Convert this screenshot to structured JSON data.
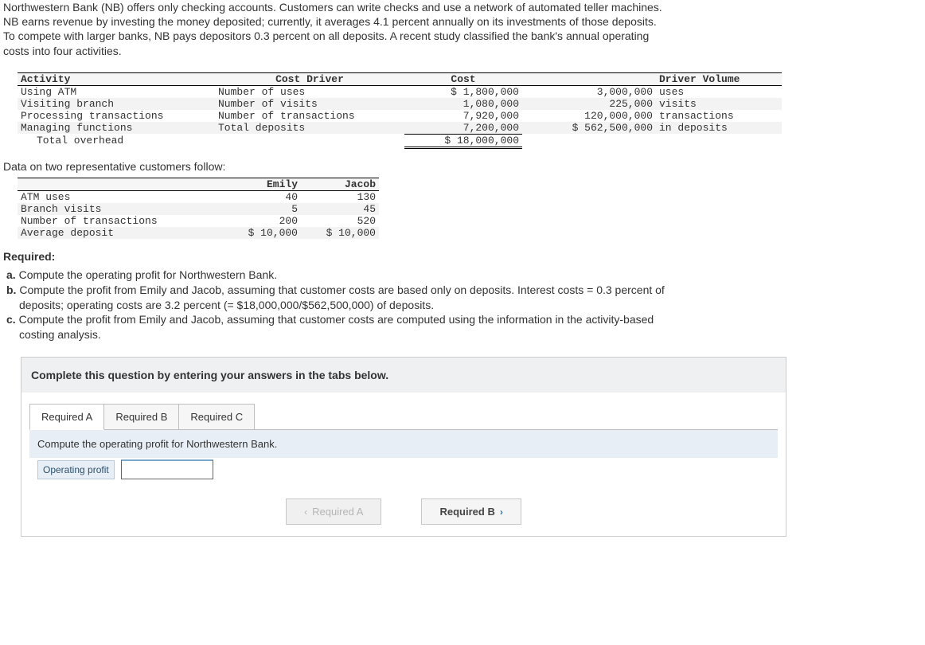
{
  "intro": {
    "line1": "Northwestern Bank (NB) offers only checking accounts. Customers can write checks and use a network of automated teller machines.",
    "line2": "NB earns revenue by investing the money deposited; currently, it averages 4.1 percent annually on its investments of those deposits.",
    "line3": "To compete with larger banks, NB pays depositors 0.3 percent on all deposits. A recent study classified the bank's annual operating",
    "line4": "costs into four activities."
  },
  "activity_table": {
    "head": {
      "activity": "Activity",
      "driver": "Cost Driver",
      "cost": "Cost",
      "volume": "Driver Volume"
    },
    "rows": [
      {
        "activity": "Using ATM",
        "driver": "Number of uses",
        "cost": "$ 1,800,000",
        "vol_num": "3,000,000",
        "vol_unit": "uses"
      },
      {
        "activity": "Visiting branch",
        "driver": "Number of visits",
        "cost": "1,080,000",
        "vol_num": "225,000",
        "vol_unit": "visits"
      },
      {
        "activity": "Processing transactions",
        "driver": "Number of transactions",
        "cost": "7,920,000",
        "vol_num": "120,000,000",
        "vol_unit": "transactions"
      },
      {
        "activity": "Managing functions",
        "driver": "Total deposits",
        "cost": "7,200,000",
        "vol_num": "$ 562,500,000",
        "vol_unit": "in deposits"
      }
    ],
    "total": {
      "label": "Total overhead",
      "cost": "$ 18,000,000"
    }
  },
  "section_customers": "Data on two representative customers follow:",
  "customer_table": {
    "head": {
      "blank": "",
      "emily": "Emily",
      "jacob": "Jacob"
    },
    "rows": [
      {
        "label": "ATM uses",
        "emily": "40",
        "jacob": "130"
      },
      {
        "label": "Branch visits",
        "emily": "5",
        "jacob": "45"
      },
      {
        "label": "Number of transactions",
        "emily": "200",
        "jacob": "520"
      },
      {
        "label": "Average deposit",
        "emily": "$ 10,000",
        "jacob": "$ 10,000"
      }
    ]
  },
  "required_heading": "Required:",
  "required": {
    "a": "Compute the operating profit for Northwestern Bank.",
    "b1": "Compute the profit from Emily and Jacob, assuming that customer costs are based only on deposits. Interest costs = 0.3 percent of",
    "b2": "deposits; operating costs are 3.2 percent (= $18,000,000/$562,500,000) of deposits.",
    "c1": "Compute the profit from Emily and Jacob, assuming that customer costs are computed using the information in the activity-based",
    "c2": "costing analysis."
  },
  "answerbox": {
    "instruction": "Complete this question by entering your answers in the tabs below.",
    "tabs": {
      "a": "Required A",
      "b": "Required B",
      "c": "Required C"
    },
    "panel_a_text": "Compute the operating profit for Northwestern Bank.",
    "row_label": "Operating profit",
    "nav": {
      "prev": "Required A",
      "next": "Required B"
    }
  }
}
